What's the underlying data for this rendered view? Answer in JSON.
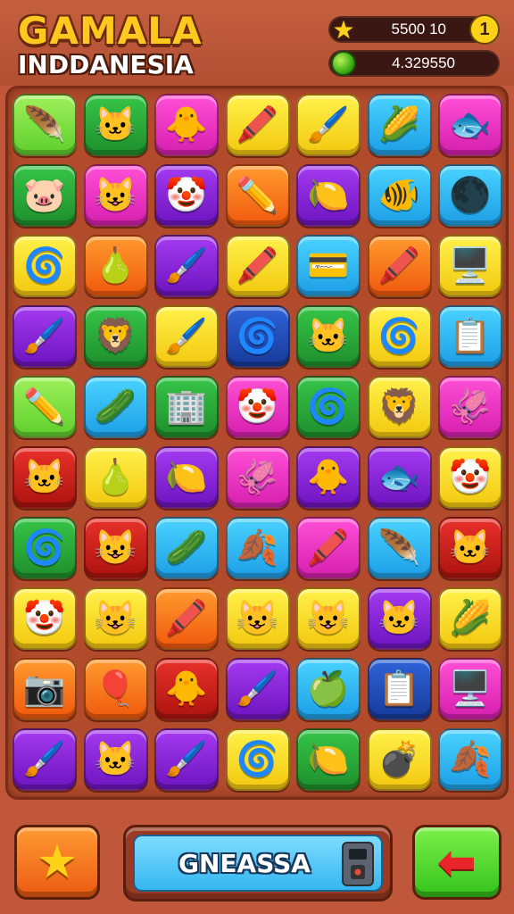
{
  "header": {
    "title_line1": "GAMALA",
    "title_line2": "INDDANESIA",
    "score_value": "5500 10",
    "score_badge": "1",
    "coins_value": "4.329550",
    "score_icon": "star-icon",
    "coins_icon": "green-orb-icon"
  },
  "board": {
    "rows": 10,
    "cols": 7,
    "tiles": [
      [
        {
          "color": "lime",
          "icon": "🪶",
          "name": "feather-icon"
        },
        {
          "color": "green",
          "icon": "🐱",
          "name": "cat-face-icon"
        },
        {
          "color": "pink",
          "icon": "🐥",
          "name": "chick-icon"
        },
        {
          "color": "yellow",
          "icon": "🖍️",
          "name": "crayon-icon"
        },
        {
          "color": "yellow",
          "icon": "🖌️",
          "name": "paintbrush-icon"
        },
        {
          "color": "blue",
          "icon": "🌽",
          "name": "corn-icon"
        },
        {
          "color": "pink",
          "icon": "🐟",
          "name": "fish-icon"
        }
      ],
      [
        {
          "color": "green",
          "icon": "🐷",
          "name": "pig-face-icon"
        },
        {
          "color": "pink",
          "icon": "😺",
          "name": "cat-face-icon"
        },
        {
          "color": "purple",
          "icon": "🤡",
          "name": "clown-icon"
        },
        {
          "color": "orange",
          "icon": "✏️",
          "name": "pencil-icon"
        },
        {
          "color": "purple",
          "icon": "🍋",
          "name": "lemon-icon"
        },
        {
          "color": "blue",
          "icon": "🐠",
          "name": "fish-icon"
        },
        {
          "color": "blue",
          "icon": "🌑",
          "name": "moon-ball-icon"
        }
      ],
      [
        {
          "color": "yellow",
          "icon": "🌀",
          "name": "spiral-icon"
        },
        {
          "color": "orange",
          "icon": "🍐",
          "name": "bulb-fruit-icon"
        },
        {
          "color": "purple",
          "icon": "🖌️",
          "name": "paintbrush-icon"
        },
        {
          "color": "yellow",
          "icon": "🖍️",
          "name": "crayon-icon"
        },
        {
          "color": "blue",
          "icon": "💳",
          "name": "wallet-icon"
        },
        {
          "color": "orange",
          "icon": "🖍️",
          "name": "marker-icon"
        },
        {
          "color": "yellow",
          "icon": "🖥️",
          "name": "screen-icon"
        }
      ],
      [
        {
          "color": "purple",
          "icon": "🖌️",
          "name": "paintbrush-icon"
        },
        {
          "color": "green",
          "icon": "🦁",
          "name": "lion-face-icon"
        },
        {
          "color": "yellow",
          "icon": "🖌️",
          "name": "paintbrush-icon"
        },
        {
          "color": "navy",
          "icon": "🌀",
          "name": "swirl-icon"
        },
        {
          "color": "green",
          "icon": "🐱",
          "name": "cat-ball-icon"
        },
        {
          "color": "yellow",
          "icon": "🌀",
          "name": "spiral-icon"
        },
        {
          "color": "blue",
          "icon": "📋",
          "name": "clipboard-icon"
        }
      ],
      [
        {
          "color": "lime",
          "icon": "✏️",
          "name": "pencil-icon"
        },
        {
          "color": "blue",
          "icon": "🥒",
          "name": "cucumber-icon"
        },
        {
          "color": "green",
          "icon": "🏢",
          "name": "building-icon"
        },
        {
          "color": "pink",
          "icon": "🤡",
          "name": "clown-icon"
        },
        {
          "color": "green",
          "icon": "🌀",
          "name": "spiral-icon"
        },
        {
          "color": "yellow",
          "icon": "🦁",
          "name": "lion-face-icon"
        },
        {
          "color": "pink",
          "icon": "🦑",
          "name": "squid-icon"
        }
      ],
      [
        {
          "color": "red",
          "icon": "🐱",
          "name": "cat-face-icon"
        },
        {
          "color": "yellow",
          "icon": "🍐",
          "name": "bulb-fruit-icon"
        },
        {
          "color": "purple",
          "icon": "🍋",
          "name": "lemon-icon"
        },
        {
          "color": "pink",
          "icon": "🦑",
          "name": "squid-icon"
        },
        {
          "color": "purple",
          "icon": "🐥",
          "name": "chick-icon"
        },
        {
          "color": "purple",
          "icon": "🐟",
          "name": "fish-icon"
        },
        {
          "color": "yellow",
          "icon": "🤡",
          "name": "clown-icon"
        }
      ],
      [
        {
          "color": "green",
          "icon": "🌀",
          "name": "spiral-icon"
        },
        {
          "color": "red",
          "icon": "😺",
          "name": "cat-face-icon"
        },
        {
          "color": "blue",
          "icon": "🥒",
          "name": "cucumber-icon"
        },
        {
          "color": "blue",
          "icon": "🍂",
          "name": "leaf-star-icon"
        },
        {
          "color": "pink",
          "icon": "🖍️",
          "name": "crayon-icon"
        },
        {
          "color": "blue",
          "icon": "🪶",
          "name": "feather-icon"
        },
        {
          "color": "red",
          "icon": "🐱",
          "name": "cat-face-icon"
        }
      ],
      [
        {
          "color": "yellow",
          "icon": "🤡",
          "name": "clown-icon"
        },
        {
          "color": "yellow",
          "icon": "😺",
          "name": "cat-face-icon"
        },
        {
          "color": "orange",
          "icon": "🖍️",
          "name": "marker-icon"
        },
        {
          "color": "yellow",
          "icon": "😺",
          "name": "cat-face-icon"
        },
        {
          "color": "yellow",
          "icon": "😺",
          "name": "cat-face-icon"
        },
        {
          "color": "purple",
          "icon": "🐱",
          "name": "cat-face-icon"
        },
        {
          "color": "yellow",
          "icon": "🌽",
          "name": "corn-icon"
        }
      ],
      [
        {
          "color": "orange",
          "icon": "📷",
          "name": "camera-icon"
        },
        {
          "color": "orange",
          "icon": "🎈",
          "name": "balloon-icon"
        },
        {
          "color": "red",
          "icon": "🐥",
          "name": "chick-icon"
        },
        {
          "color": "purple",
          "icon": "🖌️",
          "name": "paintbrush-icon"
        },
        {
          "color": "blue",
          "icon": "🍏",
          "name": "green-apple-icon"
        },
        {
          "color": "navy",
          "icon": "📋",
          "name": "clipboard-icon"
        },
        {
          "color": "pink",
          "icon": "🖥️",
          "name": "screen-icon"
        }
      ],
      [
        {
          "color": "purple",
          "icon": "🖌️",
          "name": "paintbrush-icon"
        },
        {
          "color": "purple",
          "icon": "🐱",
          "name": "cat-face-icon"
        },
        {
          "color": "purple",
          "icon": "🖌️",
          "name": "paintbrush-icon"
        },
        {
          "color": "yellow",
          "icon": "🌀",
          "name": "swirl-icon"
        },
        {
          "color": "green",
          "icon": "🍋",
          "name": "lemon-icon"
        },
        {
          "color": "yellow",
          "icon": "💣",
          "name": "bomb-icon"
        },
        {
          "color": "blue",
          "icon": "🍂",
          "name": "leaf-star-icon"
        }
      ]
    ]
  },
  "footer": {
    "star_icon": "star-icon",
    "main_button_label": "GNEASSA",
    "main_button_icon": "device-icon",
    "back_icon": "red-arrow-left-icon"
  },
  "colors": {
    "lime": "#5ecf2c",
    "green": "#1e8f2c",
    "pink": "#d61fae",
    "yellow": "#f3c80f",
    "blue": "#1d9ee6",
    "purple": "#6d14bf",
    "orange": "#f0590e",
    "red": "#ad130f",
    "navy": "#173a9a"
  }
}
